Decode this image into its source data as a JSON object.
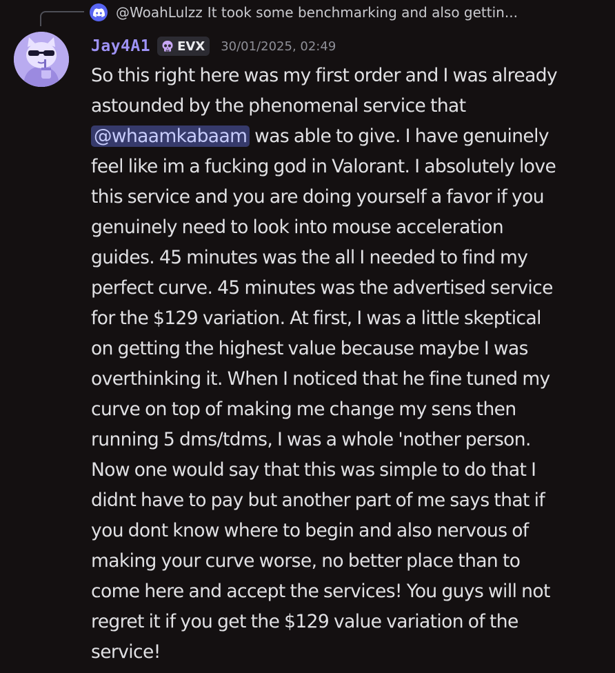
{
  "reply": {
    "username": "@WoahLulzz",
    "text": "It took some benchmarking and also gettin...",
    "icon": "discord-icon"
  },
  "author": {
    "name": "Jay4A1",
    "avatar": "cat-avatar",
    "tag_icon": "skull-icon",
    "tag": "EVX",
    "timestamp": "30/01/2025, 02:49",
    "name_color": "#9e92f5"
  },
  "message": {
    "line1": "So this right here was my first order and I was already",
    "line2": "astounded by the phenomenal service that",
    "mention": "@whaamkabaam",
    "line3_after": "was able to give. I have genuinely",
    "line4": "feel like im a fucking god in Valorant. I absolutely love",
    "line5": "this service and you are doing yourself a favor if you",
    "line6": "genuinely need to look into mouse acceleration",
    "line7": "guides. 45 minutes was the all I needed to find my",
    "line8": "perfect curve. 45 minutes was the advertised service",
    "line9": "for the $129 variation. At first, I was a little skeptical",
    "line10": "on getting the highest value because maybe I was",
    "line11": "overthinking it. When I noticed that he fine tuned my",
    "line12": "curve on top of making me change my sens then",
    "line13": "running 5 dms/tdms, I was a whole 'nother person.",
    "line14": "Now one would say that this was simple to do that I",
    "line15": "didnt have to pay but another part of me says that if",
    "line16": "you dont know where to begin and also nervous of",
    "line17": "making your curve worse, no better place than to",
    "line18": "come here and accept the services! You guys will not",
    "line19": "regret it if you get the $129 value variation of the",
    "line20": "service!"
  },
  "colors": {
    "background": "#141011",
    "mention_bg": "#363a6b",
    "mention_text": "#c8cdfc",
    "discord_blurple": "#5865f2"
  }
}
